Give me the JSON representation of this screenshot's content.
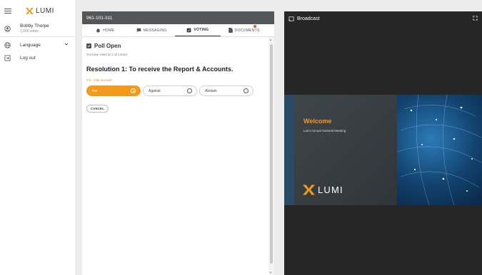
{
  "sidebar": {
    "logo_text": "LUMI",
    "user_name": "Bobby Thorpe",
    "user_sub": "1,000 votes",
    "language_label": "Language",
    "logout_label": "Log out"
  },
  "voting": {
    "header_id": "961-101-311",
    "tabs": [
      {
        "label": "HOME",
        "icon": "home-icon"
      },
      {
        "label": "MESSAGING",
        "icon": "messaging-icon"
      },
      {
        "label": "VOTING",
        "icon": "voting-icon"
      },
      {
        "label": "DOCUMENTS",
        "icon": "document-icon"
      }
    ],
    "poll_title": "Poll Open",
    "voted_text": "You have voted on 1 of 1 items",
    "resolution_title": "Resolution 1: To receive the Report & Accounts.",
    "vote_status": "For - Vote received",
    "options": [
      {
        "label": "For",
        "selected": true
      },
      {
        "label": "Against",
        "selected": false
      },
      {
        "label": "Abstain",
        "selected": false
      }
    ],
    "cancel_label": "CANCEL"
  },
  "broadcast": {
    "title": "Broadcast",
    "welcome_title": "Welcome",
    "welcome_sub": "Lumi Annual General Meeting",
    "video_logo_text": "LUMI"
  },
  "colors": {
    "accent": "#f39a1c",
    "header_bg": "#555657",
    "broadcast_bg": "#262626",
    "notification_dot": "#e8532a"
  }
}
